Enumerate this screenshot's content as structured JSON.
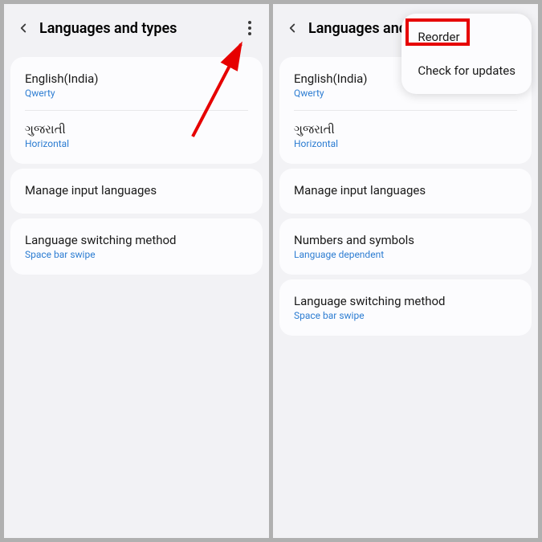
{
  "header": {
    "title": "Languages and types"
  },
  "screen1": {
    "languages": [
      {
        "name": "English(India)",
        "layout": "Qwerty"
      },
      {
        "name": "ગુજરાતી",
        "layout": "Horizontal"
      }
    ],
    "manageLanguages": "Manage input languages",
    "switchingMethod": {
      "title": "Language switching method",
      "subtitle": "Space bar swipe"
    }
  },
  "screen2": {
    "languages": [
      {
        "name": "English(India)",
        "layout": "Qwerty"
      },
      {
        "name": "ગુજરાતી",
        "layout": "Horizontal"
      }
    ],
    "manageLanguages": "Manage input languages",
    "numbersSymbols": {
      "title": "Numbers and symbols",
      "subtitle": "Language dependent"
    },
    "switchingMethod": {
      "title": "Language switching method",
      "subtitle": "Space bar swipe"
    },
    "popup": {
      "reorder": "Reorder",
      "checkUpdates": "Check for updates"
    }
  }
}
